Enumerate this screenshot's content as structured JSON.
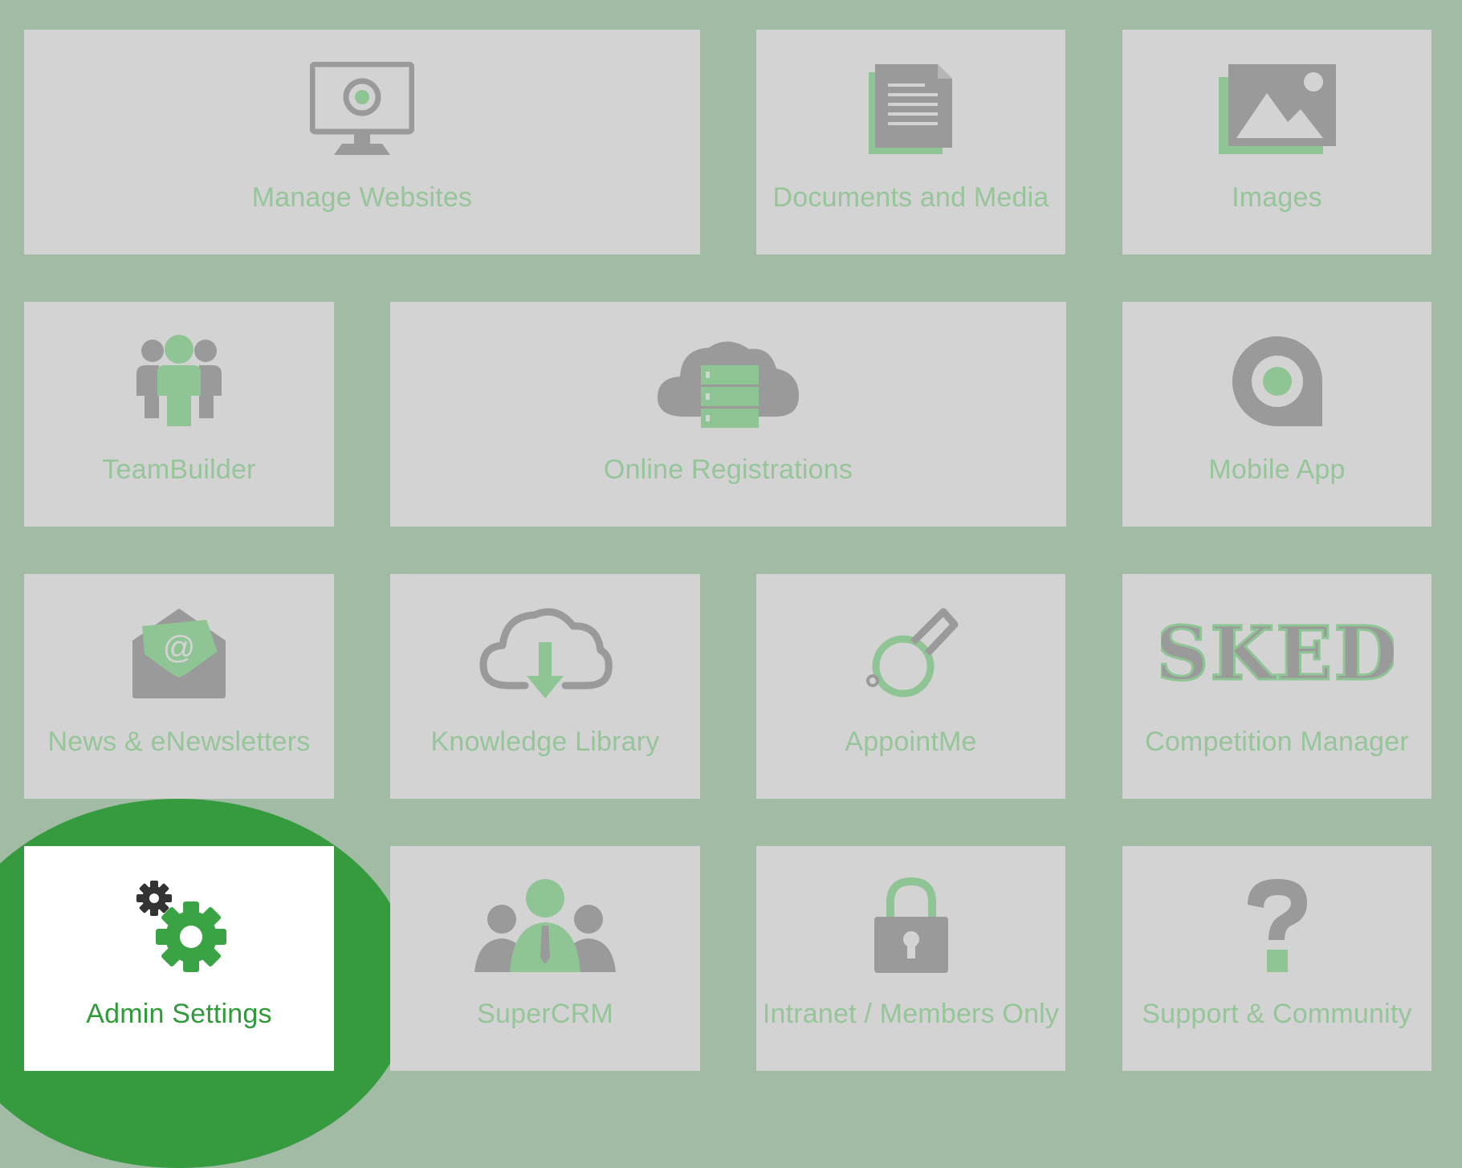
{
  "colors": {
    "background": "#a2bba4",
    "tile": "#d3d3d3",
    "tile_label": "#96c59a",
    "icon_gray": "#9a9a9a",
    "icon_green": "#8fc594",
    "highlight": "#369b3f",
    "active_tile": "#ffffff",
    "active_label": "#2e9a3a"
  },
  "tiles": [
    {
      "label": "Manage Websites",
      "icon": "monitor-icon"
    },
    {
      "label": "Documents and Media",
      "icon": "document-icon"
    },
    {
      "label": "Images",
      "icon": "image-icon"
    },
    {
      "label": "TeamBuilder",
      "icon": "team-icon"
    },
    {
      "label": "Online Registrations",
      "icon": "cloud-server-icon"
    },
    {
      "label": "Mobile App",
      "icon": "mobile-app-icon"
    },
    {
      "label": "News & eNewsletters",
      "icon": "envelope-icon"
    },
    {
      "label": "Knowledge Library",
      "icon": "cloud-download-icon"
    },
    {
      "label": "AppointMe",
      "icon": "whistle-icon"
    },
    {
      "label": "Competition Manager",
      "icon": "sked-logo",
      "logo_text": "SKED"
    },
    {
      "label": "Admin Settings",
      "icon": "gears-icon",
      "active": true
    },
    {
      "label": "SuperCRM",
      "icon": "crm-people-icon"
    },
    {
      "label": "Intranet / Members Only",
      "icon": "padlock-icon"
    },
    {
      "label": "Support & Community",
      "icon": "question-icon"
    }
  ]
}
